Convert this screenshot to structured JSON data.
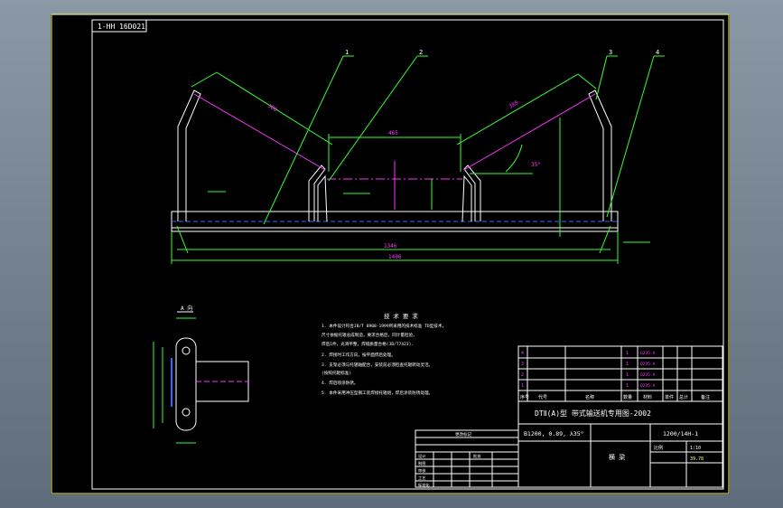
{
  "drawing_code": "1-HH 16D021",
  "callouts": [
    "1",
    "2",
    "3",
    "4"
  ],
  "view_label": "A 向",
  "tech_title": "技 术 要 求",
  "tech_lines": [
    "1. 本件设计符合JB/T 8908-1999所采用的技术标准 TD型技术，",
    "   尺寸依据托辊总成制造，要求合格后，同计量检验，",
    "   焊后1件，光滑平整，焊缝质量合格(JB/T7423).",
    "2. 焊接时工作方向，按平面焊后处理。",
    "3. 支架必须与托辊轴配合，安装前必须检查托辊转动灵活。",
    "   (按照托辊标准)",
    "4. 焊后喷涂防锈。",
    "5. 本件采用冲压型钢工装焊接托辊组，焊后涂装防锈处理。"
  ],
  "title_block": {
    "main_title": "DTⅡ(A)型 带式输送机专用图-2002",
    "spec": "B1200, 0.89, λ35°",
    "drawing_no": "1200/14H-1",
    "part_name": "横 梁",
    "scale_label": "比例",
    "scale": "1:10",
    "weight": "39.78",
    "header_cols": [
      "序号",
      "代号",
      "名称",
      "数量",
      "材料",
      "单件",
      "总计",
      "备注"
    ],
    "parts_rows": [
      {
        "no": "4",
        "code": "",
        "name": "",
        "qty": "1",
        "mat": "Q235-A",
        "w1": "",
        "w2": ""
      },
      {
        "no": "3",
        "code": "",
        "name": "",
        "qty": "1",
        "mat": "Q235-A",
        "w1": "",
        "w2": ""
      },
      {
        "no": "2",
        "code": "",
        "name": "",
        "qty": "1",
        "mat": "Q235-A",
        "w1": "",
        "w2": ""
      },
      {
        "no": "1",
        "code": "",
        "name": "",
        "qty": "1",
        "mat": "Q235-A",
        "w1": "",
        "w2": ""
      }
    ]
  },
  "revision_block": {
    "title": "更改标记",
    "rows": [
      "设计",
      "制图",
      "审核",
      "工艺",
      "标准化",
      "批准"
    ]
  },
  "colors": {
    "sheet": "#000000",
    "frame": "#ffff66",
    "outline": "#ffffff",
    "center_line": "#ff33ff",
    "dimension": "#33ff33",
    "hidden": "#3366ff"
  }
}
